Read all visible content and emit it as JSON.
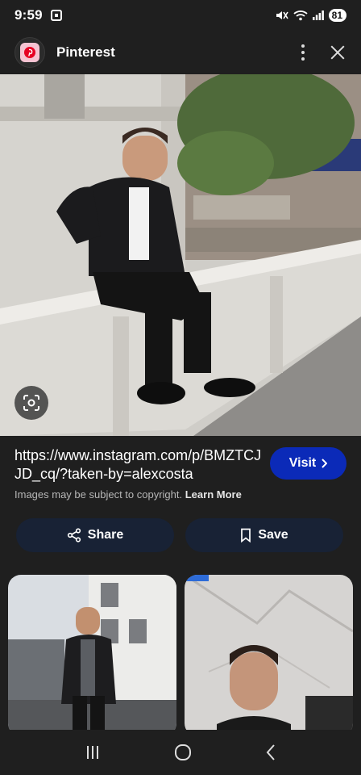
{
  "status": {
    "time": "9:59",
    "battery": "81"
  },
  "header": {
    "title": "Pinterest",
    "logo_icon": "pinterest-logo-icon",
    "more_icon": "more-vert-icon",
    "close_icon": "close-icon"
  },
  "image": {
    "lens_icon": "lens-search-icon"
  },
  "details": {
    "url": "https://www.instagram.com/p/BMZTCJJD_cq/?taken-by=alexcosta",
    "visit_label": "Visit",
    "copyright_text": "Images may be subject to copyright.",
    "learn_more": "Learn More",
    "share_label": "Share",
    "save_label": "Save"
  },
  "colors": {
    "background": "#1f1f1f",
    "visit_button": "#0b2ab8",
    "action_button": "#182235"
  },
  "nav": {
    "recent_icon": "recent-apps-icon",
    "home_icon": "home-icon",
    "back_icon": "back-icon"
  }
}
